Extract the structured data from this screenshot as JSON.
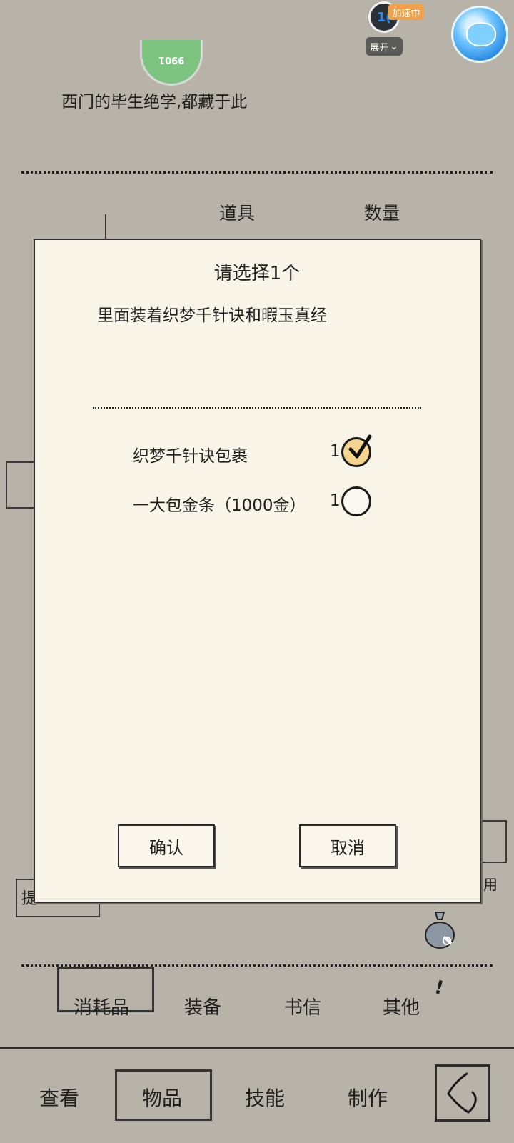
{
  "overlay": {
    "speed_widget_text": "1(",
    "speed_badge": "加速中",
    "expand_label": "展开",
    "expand_chevron": "⌄"
  },
  "background": {
    "avatar_text": "9901",
    "subtitle": "西门的毕生绝学,都藏于此",
    "column_item": "道具",
    "column_qty": "数量",
    "partial_left_text": "提",
    "partial_right_text": "用"
  },
  "modal": {
    "title": "请选择1个",
    "description": "里面装着织梦千针诀和暇玉真经",
    "options": [
      {
        "label": "织梦千针诀包裹",
        "qty": "1",
        "selected": true
      },
      {
        "label": "一大包金条（1000金）",
        "qty": "1",
        "selected": false
      }
    ],
    "confirm_label": "确认",
    "cancel_label": "取消"
  },
  "category_tabs": [
    {
      "label": "消耗品",
      "active": true
    },
    {
      "label": "装备",
      "active": false
    },
    {
      "label": "书信",
      "active": false
    },
    {
      "label": "其他",
      "active": false
    }
  ],
  "bottom_nav": [
    {
      "label": "查看",
      "active": false
    },
    {
      "label": "物品",
      "active": true
    },
    {
      "label": "技能",
      "active": false
    },
    {
      "label": "制作",
      "active": false
    }
  ],
  "icons": {
    "assistant": "game-assistant-icon",
    "bag": "money-bag-icon",
    "back": "back-icon",
    "check": "checkmark-icon"
  },
  "colors": {
    "background": "#b7b3a8",
    "modal": "#f9f4e8",
    "selected_radio": "#f5d58e",
    "badge": "#f0a14a"
  }
}
